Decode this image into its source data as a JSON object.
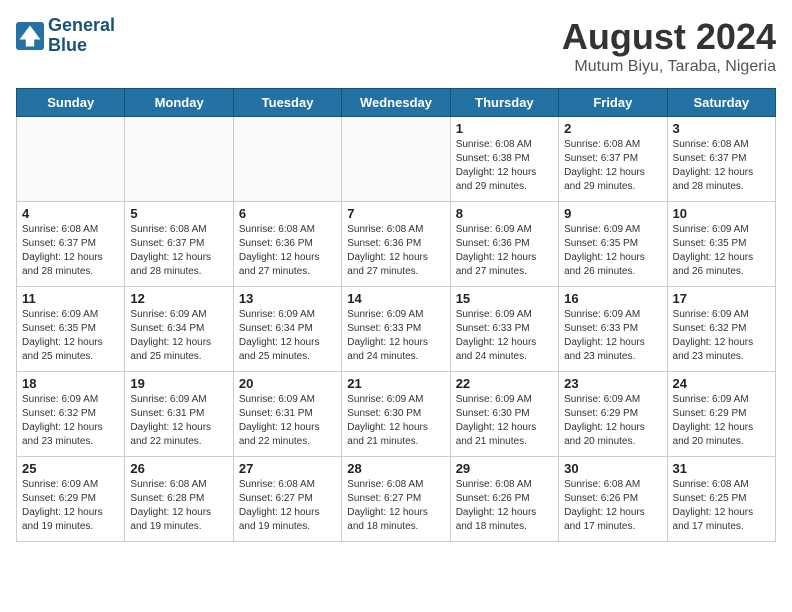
{
  "header": {
    "logo_line1": "General",
    "logo_line2": "Blue",
    "month": "August 2024",
    "location": "Mutum Biyu, Taraba, Nigeria"
  },
  "days_of_week": [
    "Sunday",
    "Monday",
    "Tuesday",
    "Wednesday",
    "Thursday",
    "Friday",
    "Saturday"
  ],
  "weeks": [
    [
      {
        "day": "",
        "info": ""
      },
      {
        "day": "",
        "info": ""
      },
      {
        "day": "",
        "info": ""
      },
      {
        "day": "",
        "info": ""
      },
      {
        "day": "1",
        "info": "Sunrise: 6:08 AM\nSunset: 6:38 PM\nDaylight: 12 hours\nand 29 minutes."
      },
      {
        "day": "2",
        "info": "Sunrise: 6:08 AM\nSunset: 6:37 PM\nDaylight: 12 hours\nand 29 minutes."
      },
      {
        "day": "3",
        "info": "Sunrise: 6:08 AM\nSunset: 6:37 PM\nDaylight: 12 hours\nand 28 minutes."
      }
    ],
    [
      {
        "day": "4",
        "info": "Sunrise: 6:08 AM\nSunset: 6:37 PM\nDaylight: 12 hours\nand 28 minutes."
      },
      {
        "day": "5",
        "info": "Sunrise: 6:08 AM\nSunset: 6:37 PM\nDaylight: 12 hours\nand 28 minutes."
      },
      {
        "day": "6",
        "info": "Sunrise: 6:08 AM\nSunset: 6:36 PM\nDaylight: 12 hours\nand 27 minutes."
      },
      {
        "day": "7",
        "info": "Sunrise: 6:08 AM\nSunset: 6:36 PM\nDaylight: 12 hours\nand 27 minutes."
      },
      {
        "day": "8",
        "info": "Sunrise: 6:09 AM\nSunset: 6:36 PM\nDaylight: 12 hours\nand 27 minutes."
      },
      {
        "day": "9",
        "info": "Sunrise: 6:09 AM\nSunset: 6:35 PM\nDaylight: 12 hours\nand 26 minutes."
      },
      {
        "day": "10",
        "info": "Sunrise: 6:09 AM\nSunset: 6:35 PM\nDaylight: 12 hours\nand 26 minutes."
      }
    ],
    [
      {
        "day": "11",
        "info": "Sunrise: 6:09 AM\nSunset: 6:35 PM\nDaylight: 12 hours\nand 25 minutes."
      },
      {
        "day": "12",
        "info": "Sunrise: 6:09 AM\nSunset: 6:34 PM\nDaylight: 12 hours\nand 25 minutes."
      },
      {
        "day": "13",
        "info": "Sunrise: 6:09 AM\nSunset: 6:34 PM\nDaylight: 12 hours\nand 25 minutes."
      },
      {
        "day": "14",
        "info": "Sunrise: 6:09 AM\nSunset: 6:33 PM\nDaylight: 12 hours\nand 24 minutes."
      },
      {
        "day": "15",
        "info": "Sunrise: 6:09 AM\nSunset: 6:33 PM\nDaylight: 12 hours\nand 24 minutes."
      },
      {
        "day": "16",
        "info": "Sunrise: 6:09 AM\nSunset: 6:33 PM\nDaylight: 12 hours\nand 23 minutes."
      },
      {
        "day": "17",
        "info": "Sunrise: 6:09 AM\nSunset: 6:32 PM\nDaylight: 12 hours\nand 23 minutes."
      }
    ],
    [
      {
        "day": "18",
        "info": "Sunrise: 6:09 AM\nSunset: 6:32 PM\nDaylight: 12 hours\nand 23 minutes."
      },
      {
        "day": "19",
        "info": "Sunrise: 6:09 AM\nSunset: 6:31 PM\nDaylight: 12 hours\nand 22 minutes."
      },
      {
        "day": "20",
        "info": "Sunrise: 6:09 AM\nSunset: 6:31 PM\nDaylight: 12 hours\nand 22 minutes."
      },
      {
        "day": "21",
        "info": "Sunrise: 6:09 AM\nSunset: 6:30 PM\nDaylight: 12 hours\nand 21 minutes."
      },
      {
        "day": "22",
        "info": "Sunrise: 6:09 AM\nSunset: 6:30 PM\nDaylight: 12 hours\nand 21 minutes."
      },
      {
        "day": "23",
        "info": "Sunrise: 6:09 AM\nSunset: 6:29 PM\nDaylight: 12 hours\nand 20 minutes."
      },
      {
        "day": "24",
        "info": "Sunrise: 6:09 AM\nSunset: 6:29 PM\nDaylight: 12 hours\nand 20 minutes."
      }
    ],
    [
      {
        "day": "25",
        "info": "Sunrise: 6:09 AM\nSunset: 6:29 PM\nDaylight: 12 hours\nand 19 minutes."
      },
      {
        "day": "26",
        "info": "Sunrise: 6:08 AM\nSunset: 6:28 PM\nDaylight: 12 hours\nand 19 minutes."
      },
      {
        "day": "27",
        "info": "Sunrise: 6:08 AM\nSunset: 6:27 PM\nDaylight: 12 hours\nand 19 minutes."
      },
      {
        "day": "28",
        "info": "Sunrise: 6:08 AM\nSunset: 6:27 PM\nDaylight: 12 hours\nand 18 minutes."
      },
      {
        "day": "29",
        "info": "Sunrise: 6:08 AM\nSunset: 6:26 PM\nDaylight: 12 hours\nand 18 minutes."
      },
      {
        "day": "30",
        "info": "Sunrise: 6:08 AM\nSunset: 6:26 PM\nDaylight: 12 hours\nand 17 minutes."
      },
      {
        "day": "31",
        "info": "Sunrise: 6:08 AM\nSunset: 6:25 PM\nDaylight: 12 hours\nand 17 minutes."
      }
    ]
  ]
}
